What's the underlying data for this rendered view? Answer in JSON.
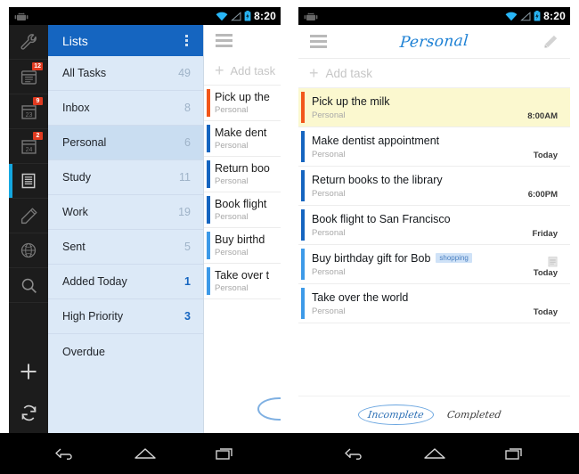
{
  "status_bar": {
    "time": "8:20",
    "icons": [
      "wifi-icon",
      "signal-icon",
      "battery-icon",
      "android-robot-icon"
    ]
  },
  "colors": {
    "header_blue": "#1565c0",
    "rail_dark": "#1c1c1c",
    "rail_selected_indicator": "#14a7e0",
    "badge_red": "#e03a20",
    "list_pane_bg": "#dce9f7",
    "list_row_active_bg": "#c9ddf1",
    "accent_count": "#1565c0",
    "highlight_row": "#fbf8cf",
    "priority_orange": "#f2561a",
    "priority_blue_dark": "#1565c0",
    "priority_blue_light": "#3d9ae8",
    "script_blue": "#1a7fd4",
    "tag_bg": "#cfe2f7",
    "tag_text": "#4a7fc0"
  },
  "left_phone": {
    "rail": {
      "items": [
        {
          "name": "wrench-icon",
          "badge": ""
        },
        {
          "name": "calendar-12-icon",
          "badge": "12"
        },
        {
          "name": "calendar-23-icon",
          "badge": "9"
        },
        {
          "name": "calendar-24-icon",
          "badge": "2"
        },
        {
          "name": "lists-icon",
          "badge": "",
          "selected": true
        },
        {
          "name": "pencil-icon",
          "badge": ""
        },
        {
          "name": "globe-icon",
          "badge": ""
        },
        {
          "name": "search-icon",
          "badge": ""
        }
      ],
      "bottom_items": [
        {
          "name": "add-icon"
        },
        {
          "name": "sync-icon"
        }
      ]
    },
    "lists_pane": {
      "header_title": "Lists",
      "overflow_icon": "kebab-menu-icon",
      "rows": [
        {
          "label": "All Tasks",
          "count": "49",
          "accent": false,
          "active": false
        },
        {
          "label": "Inbox",
          "count": "8",
          "accent": false,
          "active": false
        },
        {
          "label": "Personal",
          "count": "6",
          "accent": false,
          "active": true
        },
        {
          "label": "Study",
          "count": "11",
          "accent": false,
          "active": false
        },
        {
          "label": "Work",
          "count": "19",
          "accent": false,
          "active": false
        },
        {
          "label": "Sent",
          "count": "5",
          "accent": false,
          "active": false
        },
        {
          "label": "Added Today",
          "count": "1",
          "accent": true,
          "active": false
        },
        {
          "label": "High Priority",
          "count": "3",
          "accent": true,
          "active": false
        },
        {
          "label": "Overdue",
          "count": "",
          "accent": false,
          "active": false
        }
      ]
    },
    "tasks_peek": {
      "menu_icon": "hamburger-icon",
      "add_task_label": "Add task",
      "add_task_icon": "plus-icon",
      "items": [
        {
          "title": "Pick up the",
          "sub": "Personal",
          "bar": "#f2561a"
        },
        {
          "title": "Make dent",
          "sub": "Personal",
          "bar": "#1565c0"
        },
        {
          "title": "Return boo",
          "sub": "Personal",
          "bar": "#1565c0"
        },
        {
          "title": "Book flight",
          "sub": "Personal",
          "bar": "#1565c0"
        },
        {
          "title": "Buy birthd",
          "sub": "Personal",
          "bar": "#3d9ae8"
        },
        {
          "title": "Take over t",
          "sub": "Personal",
          "bar": "#3d9ae8"
        }
      ]
    }
  },
  "right_phone": {
    "header": {
      "menu_icon": "hamburger-icon",
      "title": "Personal",
      "edit_icon": "pencil-icon"
    },
    "add_task_label": "Add task",
    "add_task_icon": "plus-icon",
    "tasks": [
      {
        "title": "Pick up the milk",
        "list": "Personal",
        "due": "8:00AM",
        "bar": "#f2561a",
        "highlight": true,
        "tag": "",
        "note": false
      },
      {
        "title": "Make dentist appointment",
        "list": "Personal",
        "due": "Today",
        "bar": "#1565c0",
        "highlight": false,
        "tag": "",
        "note": false
      },
      {
        "title": "Return books to the library",
        "list": "Personal",
        "due": "6:00PM",
        "bar": "#1565c0",
        "highlight": false,
        "tag": "",
        "note": false
      },
      {
        "title": "Book flight to San Francisco",
        "list": "Personal",
        "due": "Friday",
        "bar": "#1565c0",
        "highlight": false,
        "tag": "",
        "note": false
      },
      {
        "title": "Buy birthday gift for Bob",
        "list": "Personal",
        "due": "Today",
        "bar": "#3d9ae8",
        "highlight": false,
        "tag": "shopping",
        "note": true
      },
      {
        "title": "Take over the world",
        "list": "Personal",
        "due": "Today",
        "bar": "#3d9ae8",
        "highlight": false,
        "tag": "",
        "note": false
      }
    ],
    "footer": {
      "incomplete_label": "Incomplete",
      "completed_label": "Completed",
      "selected": "Incomplete"
    }
  },
  "nav_bar": {
    "back_icon": "back-icon",
    "home_icon": "home-icon",
    "recents_icon": "recents-icon"
  }
}
